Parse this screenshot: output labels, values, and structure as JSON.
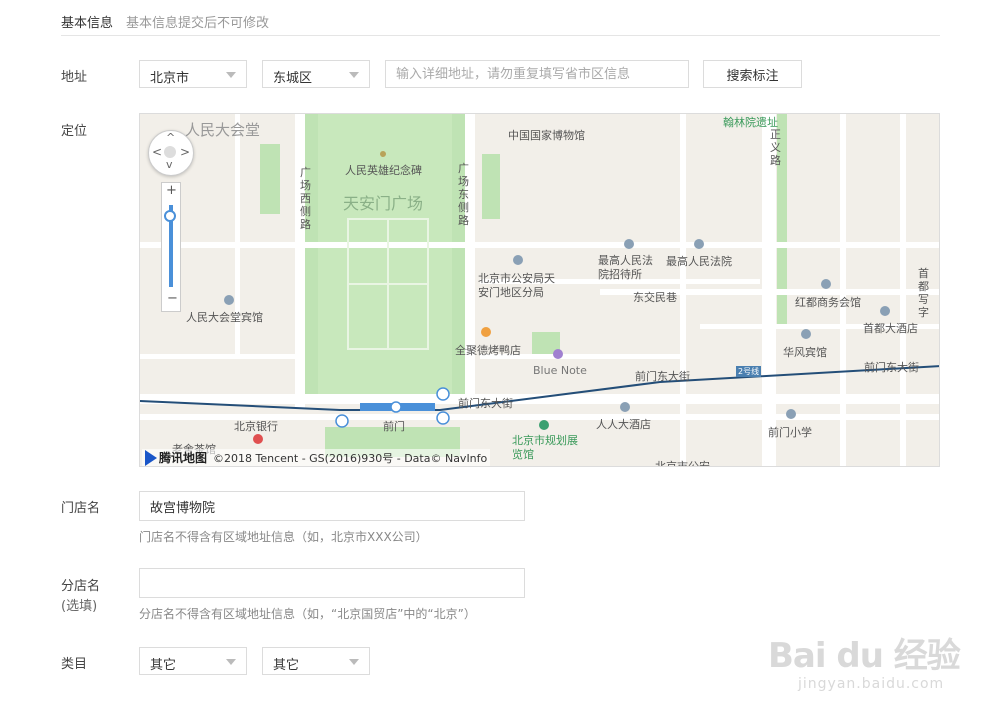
{
  "section": {
    "title": "基本信息",
    "note": "基本信息提交后不可修改"
  },
  "address": {
    "label": "地址",
    "city": "北京市",
    "district": "东城区",
    "detail_placeholder": "输入详细地址，请勿重复填写省市区信息",
    "search_button": "搜索标注"
  },
  "location": {
    "label": "定位",
    "map": {
      "attribution_brand": "腾讯地图",
      "attribution_text": "©2018 Tencent - GS(2016)930号 - Data© NavInfo",
      "labels": {
        "great_hall": "人民大会堂",
        "museum": "中国国家博物馆",
        "monument": "人民英雄纪念碑",
        "square": "天安门广场",
        "west_side": "广场西侧路",
        "east_side": "广场东侧路",
        "hanlin": "翰林院遗址",
        "zhengyi": "正义路",
        "court_hotel": "最高人民法院招待所",
        "court": "最高人民法院",
        "police": "北京市公安局天安门地区分局",
        "dongjiaomin": "东交民巷",
        "hongdu": "红都商务会馆",
        "capital": "首都大酒店",
        "capital2": "首都写字",
        "great_hall_hotel": "人民大会堂宾馆",
        "huafeng": "华风宾馆",
        "quanjude": "全聚德烤鸭店",
        "bluenote": "Blue Note",
        "qianmen_east1": "前门东大街",
        "qianmen_east2": "前门东大街",
        "qianmen_east3": "前门东大街",
        "line2": "2号线",
        "bank": "北京银行",
        "qianmen": "前门",
        "laoshe": "老舍茶馆",
        "renren": "人人大酒店",
        "planning": "北京市规划展览馆",
        "qianmen_school": "前门小学",
        "police2": "北京市公安"
      }
    }
  },
  "store": {
    "label": "门店名",
    "value": "故宫博物院",
    "hint": "门店名不得含有区域地址信息（如，北京市XXX公司）"
  },
  "branch": {
    "label": "分店名",
    "label_optional": "(选填)",
    "value": "",
    "hint": "分店名不得含有区域地址信息（如，“北京国贸店”中的“北京”）"
  },
  "category": {
    "label": "类目",
    "primary": "其它",
    "secondary": "其它"
  },
  "watermark": {
    "brand": "Bai du 经验",
    "url": "jingyan.baidu.com"
  }
}
